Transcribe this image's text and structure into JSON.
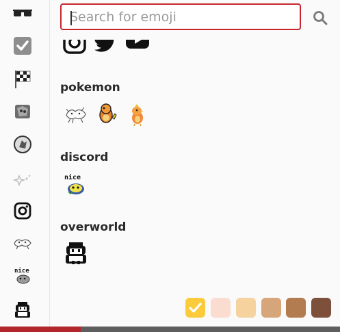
{
  "search": {
    "placeholder": "Search for emoji",
    "value": ""
  },
  "sidebar": {
    "categories": [
      {
        "name": "sunglasses-icon"
      },
      {
        "name": "check-box-icon"
      },
      {
        "name": "checkered-flag-icon"
      },
      {
        "name": "custom-sticker-icon"
      },
      {
        "name": "custom-badge-icon"
      },
      {
        "name": "sparkle-stars-icon"
      },
      {
        "name": "instagram-icon"
      },
      {
        "name": "pokemon-icon"
      },
      {
        "name": "nice-sticker-icon"
      },
      {
        "name": "overworld-character-icon"
      }
    ]
  },
  "sections": [
    {
      "title": "",
      "items": [
        "instagram",
        "twitter",
        "youtube"
      ]
    },
    {
      "title": "pokemon",
      "items": [
        "pokemon-sketch",
        "charmander",
        "torchic"
      ]
    },
    {
      "title": "discord",
      "items": [
        "nice-pixel"
      ]
    },
    {
      "title": "overworld",
      "items": [
        "overworld-character"
      ]
    }
  ],
  "skin_tones": {
    "selected": 0,
    "colors": [
      "#fbcb3c",
      "#fadcd0",
      "#f5d29e",
      "#d7a57a",
      "#b27b50",
      "#7c503b"
    ]
  }
}
